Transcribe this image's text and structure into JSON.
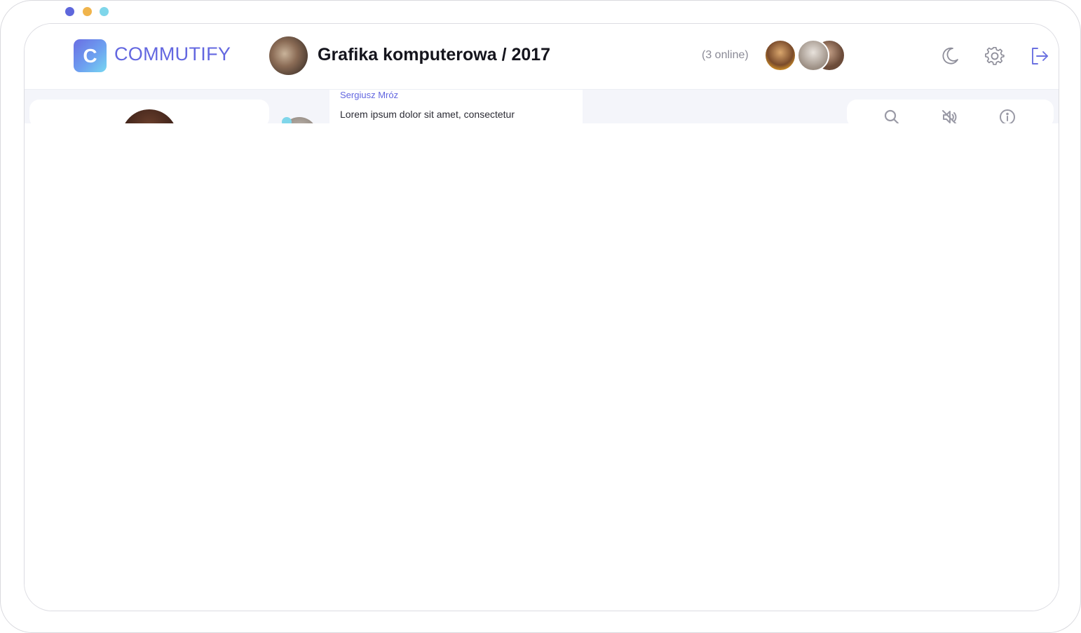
{
  "window": {
    "controls": [
      {
        "name": "blue",
        "color": "#5e67dc"
      },
      {
        "name": "yellow",
        "color": "#f0b44c"
      },
      {
        "name": "cyan",
        "color": "#7fd6ea"
      }
    ]
  },
  "brand": {
    "logo_letter": "C",
    "name": "COMMUTIFY",
    "color": "#6367e0"
  },
  "chat": {
    "title": "Grafika komputerowa / 2017",
    "online_text": "(3 online)",
    "avatar_icon": "group-photo"
  },
  "header_actions": [
    {
      "name": "dark-mode",
      "icon": "moon-icon"
    },
    {
      "name": "settings",
      "icon": "gear-icon"
    },
    {
      "name": "logout",
      "icon": "logout-icon"
    }
  ],
  "message": {
    "author": "Sergiusz Mróz",
    "text": "Lorem ipsum dolor sit amet, consectetur"
  },
  "chat_tools": [
    {
      "name": "search",
      "icon": "search-icon"
    },
    {
      "name": "mute",
      "icon": "mute-icon"
    },
    {
      "name": "info",
      "icon": "info-icon"
    }
  ]
}
